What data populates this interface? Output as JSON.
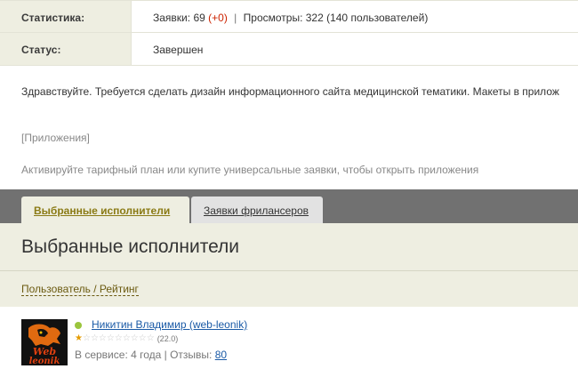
{
  "info": {
    "stats_label": "Статистика:",
    "stats_requests_label": "Заявки:",
    "stats_requests_count": "69",
    "stats_requests_delta": "(+0)",
    "stats_separator": "|",
    "stats_views": "Просмотры: 322 (140 пользователей)",
    "status_label": "Статус:",
    "status_value": "Завершен"
  },
  "description": "Здравствуйте. Требуется сделать дизайн информационного сайта медицинской тематики. Макеты в прилож",
  "attachments_label": "[Приложения]",
  "activate_notice": "Активируйте тарифный план или купите универсальные заявки, чтобы открыть приложения",
  "tabs": [
    {
      "label": "Выбранные исполнители",
      "active": true
    },
    {
      "label": "Заявки фрилансеров",
      "active": false
    }
  ],
  "section": {
    "title": "Выбранные исполнители",
    "sort_label": "Пользователь / Рейтинг"
  },
  "user": {
    "name": "Никитин Владимир (web-leonik)",
    "online": true,
    "rating_stars_filled": 0.5,
    "rating_stars_total": 10,
    "rating_value": "(22.0)",
    "meta_prefix": "В сервисе: 4 года | Отзывы:",
    "reviews_count": "80",
    "avatar_text_line1": "Web",
    "avatar_text_line2": "leonik"
  },
  "colors": {
    "accent_tab": "#8a7a14",
    "link": "#1a5aa6",
    "delta": "#cc2200",
    "panel_bg": "#eeeee1",
    "tabs_bar": "#717171",
    "online": "#9bc53d",
    "star_filled": "#e59b00"
  }
}
